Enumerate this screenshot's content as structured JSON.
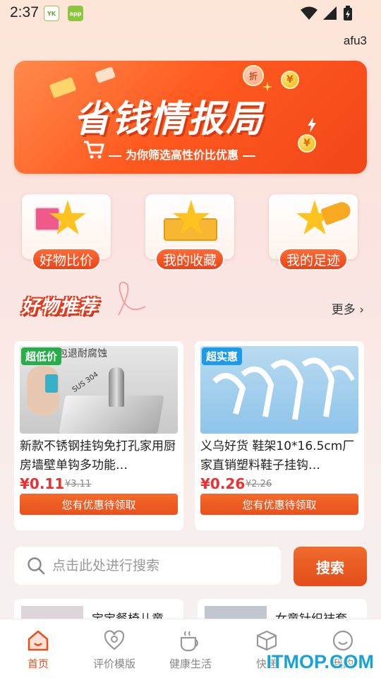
{
  "status_bar": {
    "time": "2:37",
    "app_icon_1": "YK",
    "app_icon_2": "app"
  },
  "header": {
    "user_label": "afu3"
  },
  "banner": {
    "title": "省钱情报局",
    "subtitle": "为你筛选高性价比优惠",
    "coin_symbol": "¥",
    "tag": "折",
    "colors": {
      "accent": "#ff5a1f"
    }
  },
  "quick_actions": [
    {
      "label": "好物比价",
      "icon": "gift-star-icon"
    },
    {
      "label": "我的收藏",
      "icon": "box-star-icon"
    },
    {
      "label": "我的足迹",
      "icon": "megaphone-star-icon"
    }
  ],
  "section": {
    "title": "好物推荐",
    "more_label": "更多"
  },
  "products": [
    {
      "badge": "超低价",
      "badge_color": "#28b04a",
      "image_caption": "包退耐腐蚀",
      "image_text": "SUS 304",
      "title": "新款不锈钢挂钩免打孔家用厨房墙壁单钩多功能…",
      "price": "¥0.11",
      "original_price": "¥3.11",
      "coupon_label": "您有优惠待领取"
    },
    {
      "badge": "超实惠",
      "badge_color": "#1e9be8",
      "title": "义乌好货 鞋架10*16.5cm厂家直销塑料鞋子挂钩…",
      "price": "¥0.26",
      "original_price": "¥2.26",
      "coupon_label": "您有优惠待领取"
    }
  ],
  "search": {
    "placeholder": "点击此处进行搜索",
    "button_label": "搜索"
  },
  "list_preview": [
    {
      "title": "宝宝餐椅儿童"
    },
    {
      "title": "女童针织袜套"
    }
  ],
  "bottom_nav": [
    {
      "label": "首页",
      "icon": "home-icon",
      "active": true
    },
    {
      "label": "评价模版",
      "icon": "review-icon",
      "active": false
    },
    {
      "label": "健康生活",
      "icon": "cup-icon",
      "active": false
    },
    {
      "label": "快递",
      "icon": "package-icon",
      "active": false
    },
    {
      "label": "我的",
      "icon": "profile-icon",
      "active": false
    }
  ],
  "watermark": "ITMOP.COM"
}
